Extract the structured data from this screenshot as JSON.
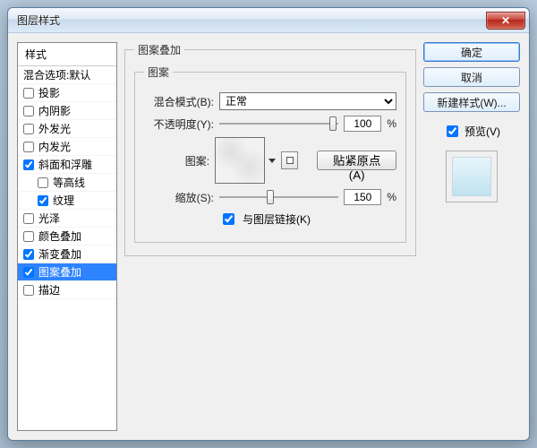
{
  "window": {
    "title": "图层样式",
    "close_glyph": "✕"
  },
  "sidebar": {
    "header": "样式",
    "blend_options": "混合选项:默认",
    "items": [
      {
        "label": "投影",
        "checked": false,
        "indent": false
      },
      {
        "label": "内阴影",
        "checked": false,
        "indent": false
      },
      {
        "label": "外发光",
        "checked": false,
        "indent": false
      },
      {
        "label": "内发光",
        "checked": false,
        "indent": false
      },
      {
        "label": "斜面和浮雕",
        "checked": true,
        "indent": false
      },
      {
        "label": "等高线",
        "checked": false,
        "indent": true
      },
      {
        "label": "纹理",
        "checked": true,
        "indent": true
      },
      {
        "label": "光泽",
        "checked": false,
        "indent": false
      },
      {
        "label": "颜色叠加",
        "checked": false,
        "indent": false
      },
      {
        "label": "渐变叠加",
        "checked": true,
        "indent": false
      },
      {
        "label": "图案叠加",
        "checked": true,
        "indent": false,
        "selected": true
      },
      {
        "label": "描边",
        "checked": false,
        "indent": false
      }
    ]
  },
  "main": {
    "section_title": "图案叠加",
    "group_title": "图案",
    "blend_mode_label": "混合模式(B):",
    "blend_mode_value": "正常",
    "opacity_label": "不透明度(Y):",
    "opacity_value": "100",
    "opacity_unit": "%",
    "pattern_label": "图案:",
    "snap_button": "贴紧原点(A)",
    "scale_label": "缩放(S):",
    "scale_value": "150",
    "scale_unit": "%",
    "link_label": "与图层链接(K)",
    "link_checked": true
  },
  "actions": {
    "ok": "确定",
    "cancel": "取消",
    "new_style": "新建样式(W)...",
    "preview_label": "预览(V)",
    "preview_checked": true
  }
}
